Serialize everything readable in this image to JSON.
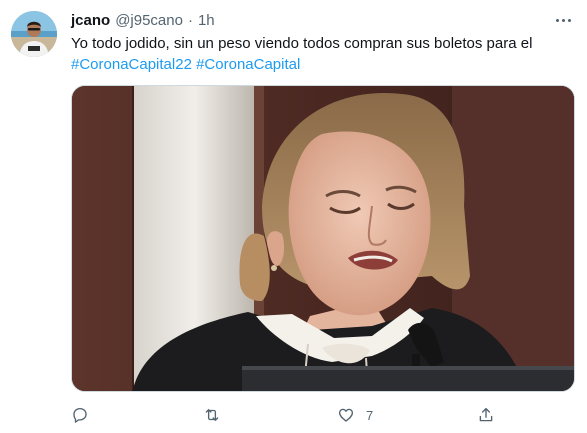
{
  "tweet": {
    "display_name": "jcano",
    "handle": "@j95cano",
    "separator": "·",
    "time": "1h",
    "text": "Yo todo jodido, sin un peso viendo todos compran sus boletos para el",
    "hashtags": [
      "#CoronaCapital22",
      "#CoronaCapital"
    ]
  },
  "actions": {
    "reply_icon": "reply-icon",
    "retweet_icon": "retweet-icon",
    "like_icon": "heart-icon",
    "like_count": "7",
    "share_icon": "share-icon"
  },
  "colors": {
    "link": "#1d9bf0",
    "muted": "#536471",
    "text": "#0f1419"
  }
}
